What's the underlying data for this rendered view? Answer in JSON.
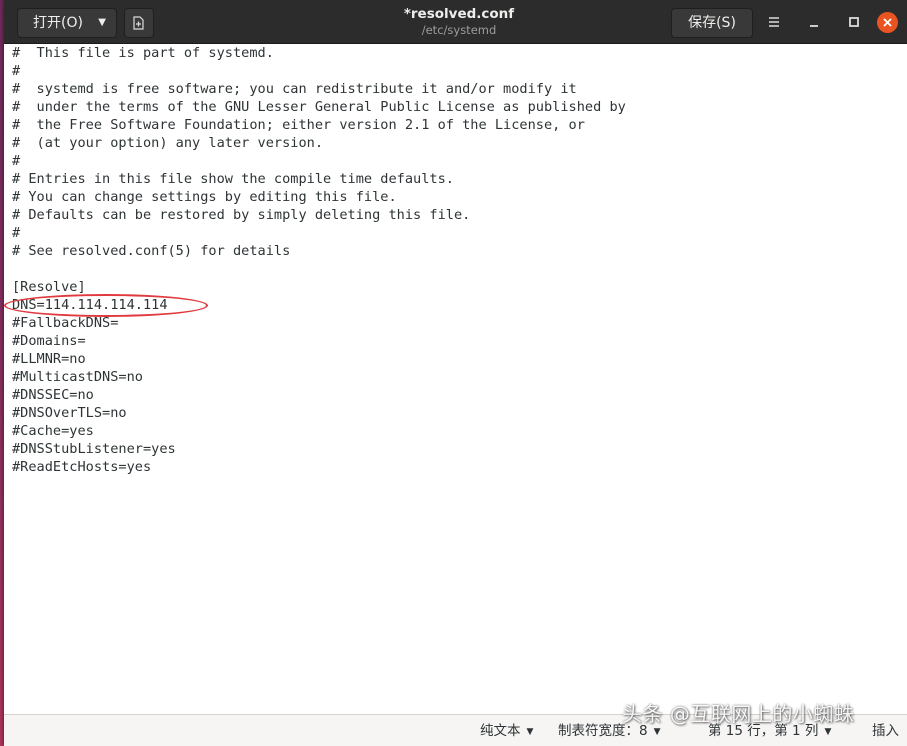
{
  "header": {
    "open_label": "打开(O)",
    "save_label": "保存(S)",
    "title": "*resolved.conf",
    "subtitle": "/etc/systemd"
  },
  "editor": {
    "lines": [
      "#  This file is part of systemd.",
      "#",
      "#  systemd is free software; you can redistribute it and/or modify it",
      "#  under the terms of the GNU Lesser General Public License as published by",
      "#  the Free Software Foundation; either version 2.1 of the License, or",
      "#  (at your option) any later version.",
      "#",
      "# Entries in this file show the compile time defaults.",
      "# You can change settings by editing this file.",
      "# Defaults can be restored by simply deleting this file.",
      "#",
      "# See resolved.conf(5) for details",
      "",
      "[Resolve]",
      "DNS=114.114.114.114",
      "#FallbackDNS=",
      "#Domains=",
      "#LLMNR=no",
      "#MulticastDNS=no",
      "#DNSSEC=no",
      "#DNSOverTLS=no",
      "#Cache=yes",
      "#DNSStubListener=yes",
      "#ReadEtcHosts=yes"
    ],
    "highlight_color": "#e03a3e"
  },
  "statusbar": {
    "language": "纯文本",
    "tab_width": "制表符宽度：8",
    "position": "第 15 行，第 1 列",
    "insert_mode": "插入"
  },
  "watermark": "头条 @互联网上的小蜘蛛",
  "colors": {
    "headerbar": "#2c2c2c",
    "close_button": "#e95420",
    "desktop": "#8a2f5e"
  }
}
